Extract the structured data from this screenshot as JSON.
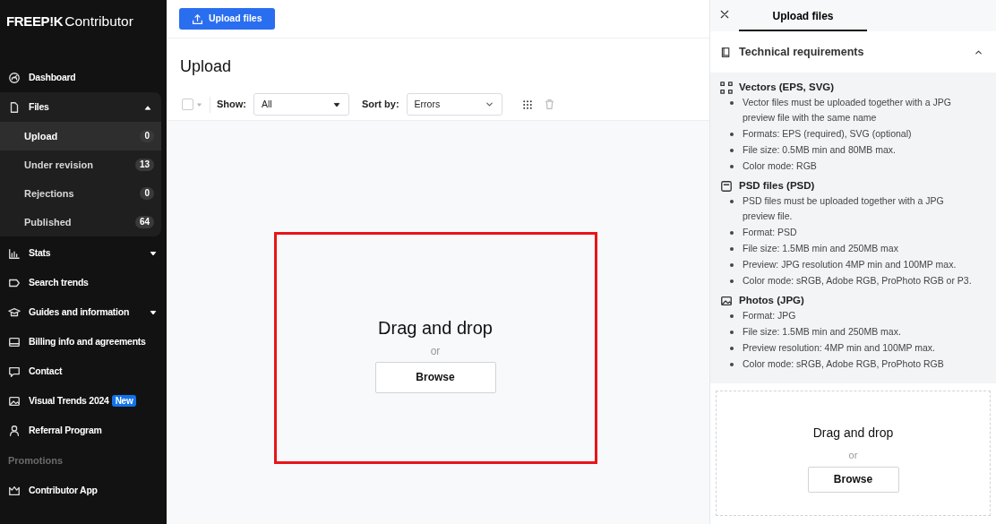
{
  "sidebar": {
    "logo": {
      "brand": "FREEP!K",
      "product": "Contributor"
    },
    "items": [
      {
        "kind": "link",
        "label": "Dashboard"
      },
      {
        "kind": "group",
        "label": "Files",
        "expanded": true,
        "children": [
          {
            "label": "Upload",
            "count": "0",
            "selected": true
          },
          {
            "label": "Under revision",
            "count": "13",
            "selected": false
          },
          {
            "label": "Rejections",
            "count": "0",
            "selected": false
          },
          {
            "label": "Published",
            "count": "64",
            "selected": false
          }
        ]
      },
      {
        "kind": "group",
        "label": "Stats",
        "expanded": false
      },
      {
        "kind": "link",
        "label": "Search trends"
      },
      {
        "kind": "group",
        "label": "Guides and information",
        "expanded": false
      },
      {
        "kind": "link",
        "label": "Billing info and agreements"
      },
      {
        "kind": "link",
        "label": "Contact"
      },
      {
        "kind": "link",
        "label": "Visual Trends 2024",
        "badge": "New"
      },
      {
        "kind": "link",
        "label": "Referral Program"
      },
      {
        "kind": "section",
        "label": "Promotions"
      },
      {
        "kind": "link",
        "label": "Contributor App"
      }
    ]
  },
  "topbar": {
    "upload_button": "Upload files"
  },
  "main": {
    "title": "Upload",
    "toolbar": {
      "select_all_checked": false,
      "show_label": "Show:",
      "show_value": "All",
      "sort_label": "Sort by:",
      "sort_value": "Errors"
    },
    "dropzone": {
      "title": "Drag and drop",
      "or": "or",
      "button": "Browse",
      "highlighted": true
    }
  },
  "panel": {
    "tab": "Upload files",
    "section": {
      "title": "Technical requirements",
      "expanded": true,
      "groups": [
        {
          "title": "Vectors (EPS, SVG)",
          "items": [
            "Vector files must be uploaded together with a JPG preview file with the same name",
            "Formats: EPS (required), SVG (optional)",
            "File size: 0.5MB min and 80MB max.",
            "Color mode: RGB"
          ]
        },
        {
          "title": "PSD files (PSD)",
          "items": [
            "PSD files must be uploaded together with a JPG preview file.",
            "Format: PSD",
            "File size: 1.5MB min and 250MB max",
            "Preview: JPG resolution 4MP min and 100MP max.",
            "Color mode: sRGB, Adobe RGB, ProPhoto RGB or P3."
          ]
        },
        {
          "title": "Photos (JPG)",
          "items": [
            "Format: JPG",
            "File size: 1.5MB min and 250MB max.",
            "Preview resolution: 4MP min and 100MP max.",
            "Color mode: sRGB, Adobe RGB, ProPhoto RGB"
          ]
        }
      ]
    },
    "dropzone": {
      "title": "Drag and drop",
      "or": "or",
      "button": "Browse"
    }
  }
}
